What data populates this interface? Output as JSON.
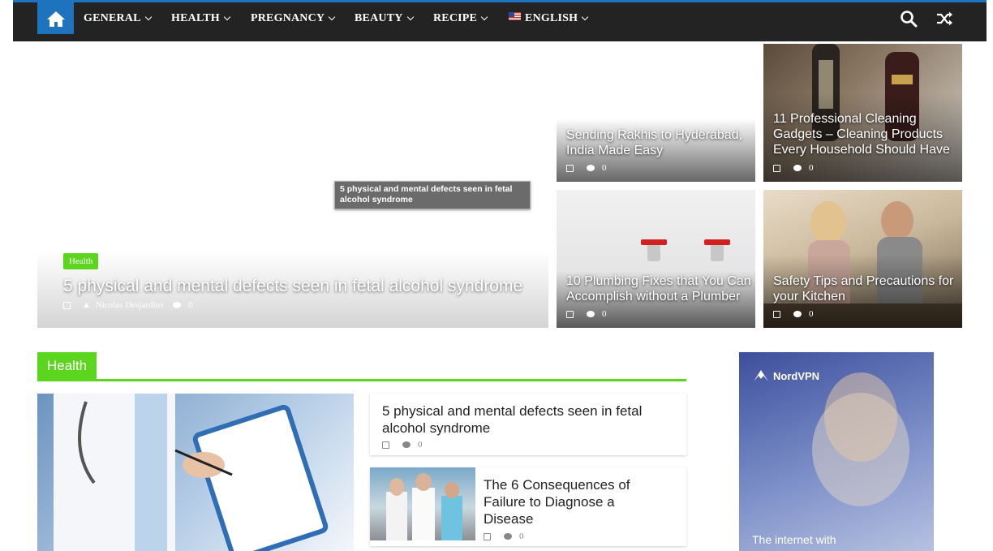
{
  "nav": {
    "items": [
      {
        "label": "GENERAL"
      },
      {
        "label": "HEALTH"
      },
      {
        "label": "PREGNANCY"
      },
      {
        "label": "BEAUTY"
      },
      {
        "label": "RECIPE"
      },
      {
        "label": "ENGLISH"
      }
    ]
  },
  "hero": {
    "category": "Health",
    "title": "5 physical and mental defects seen in fetal alcohol syndrome",
    "author": "Nicolas Desjardins",
    "comments": "0",
    "tooltip": "5 physical and mental defects seen in fetal alcohol syndrome"
  },
  "tiles": [
    {
      "title": "Sending Rakhis to Hyderabad, India Made Easy",
      "comments": "0"
    },
    {
      "title": "11 Professional Cleaning Gadgets – Cleaning Products Every Household Should Have",
      "comments": "0"
    },
    {
      "title": "10 Plumbing Fixes that You Can Accomplish without a Plumber",
      "comments": "0"
    },
    {
      "title": "Safety Tips and Precautions for your Kitchen",
      "comments": "0"
    }
  ],
  "section": {
    "title": "Health",
    "posts": [
      {
        "title": "5 physical and mental defects seen in fetal alcohol syndrome",
        "comments": "0"
      },
      {
        "title": "The 6 Consequences of Failure to Diagnose a Disease",
        "comments": "0"
      }
    ]
  },
  "ad": {
    "brand": "NordVPN",
    "tagline": "The internet with"
  },
  "colors": {
    "accent_blue": "#1e73be",
    "category_green": "#5cd51f",
    "nav_bg": "#232323"
  }
}
